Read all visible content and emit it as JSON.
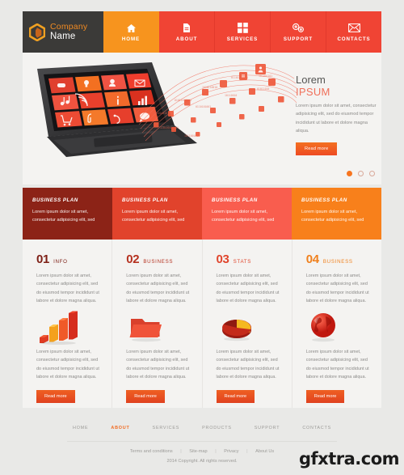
{
  "brand": {
    "logo_icon": "hexagon-ring-icon",
    "name_line1": "Company",
    "name_line2": "Name",
    "accent_orange": "#f7941e",
    "accent_red": "#f04434"
  },
  "nav": {
    "items": [
      {
        "label": "HOME",
        "icon": "home-icon",
        "active": true
      },
      {
        "label": "ABOUT",
        "icon": "document-icon",
        "active": false
      },
      {
        "label": "SERVICES",
        "icon": "grid-icon",
        "active": false
      },
      {
        "label": "SUPPORT",
        "icon": "gears-icon",
        "active": false
      },
      {
        "label": "CONTACTS",
        "icon": "envelope-icon",
        "active": false
      }
    ]
  },
  "hero": {
    "image_alt": "laptop-with-app-tiles",
    "title_line1": "Lorem",
    "title_line2": "IPSUM",
    "paragraph": "Lorem ipsum dolor sit amet, consectetur adipisicing elit, sed do eiusmod tempor incididunt ut labore et dolore magna aliqua.",
    "button_label": "Read more",
    "slider_dots": 3,
    "slider_active_index": 0
  },
  "plans": [
    {
      "title": "BUSINESS PLAN",
      "text": "Lorem ipsum dolor sit amet, consectetur adipisicing elit, sed",
      "color": "#8c2317"
    },
    {
      "title": "BUSINESS PLAN",
      "text": "Lorem ipsum dolor sit amet, consectetur adipisicing elit, sed",
      "color": "#e1432c"
    },
    {
      "title": "BUSINESS PLAN",
      "text": "Lorem ipsum dolor sit amet, consectetur adipisicing elit, sed",
      "color": "#f95d4e"
    },
    {
      "title": "BUSINESS PLAN",
      "text": "Lorem ipsum dolor sit amet, consectetur adipisicing elit, sed",
      "color": "#f8801b"
    }
  ],
  "columns": [
    {
      "number": "01",
      "word": "INFO",
      "color": "#7e2016",
      "art": "bar-chart-3d-icon",
      "text_top": "Lorem ipsum dolor sit amet, consectetur adipisicing elit, sed do eiusmod tempor incididunt ut labore et dolore magna aliqua.",
      "text_bottom": "Lorem ipsum dolor sit amet, consectetur adipisicing elit, sed do eiusmod tempor incididunt ut labore et dolore magna aliqua.",
      "button_label": "Read more"
    },
    {
      "number": "02",
      "word": "BUSINESS",
      "color": "#b5311f",
      "art": "folder-icon",
      "text_top": "Lorem ipsum dolor sit amet, consectetur adipisicing elit, sed do eiusmod tempor incididunt ut labore et dolore magna aliqua.",
      "text_bottom": "Lorem ipsum dolor sit amet, consectetur adipisicing elit, sed do eiusmod tempor incididunt ut labore et dolore magna aliqua.",
      "button_label": "Read more"
    },
    {
      "number": "03",
      "word": "STATS",
      "color": "#e0452c",
      "art": "pie-chart-icon",
      "text_top": "Lorem ipsum dolor sit amet, consectetur adipisicing elit, sed do eiusmod tempor incididunt ut labore et dolore magna aliqua.",
      "text_bottom": "Lorem ipsum dolor sit amet, consectetur adipisicing elit, sed do eiusmod tempor incididunt ut labore et dolore magna aliqua.",
      "button_label": "Read more"
    },
    {
      "number": "04",
      "word": "BUSINESS",
      "color": "#f0801d",
      "art": "globe-icon",
      "text_top": "Lorem ipsum dolor sit amet, consectetur adipisicing elit, sed do eiusmod tempor incididunt ut labore et dolore magna aliqua.",
      "text_bottom": "Lorem ipsum dolor sit amet, consectetur adipisicing elit, sed do eiusmod tempor incididunt ut labore et dolore magna aliqua.",
      "button_label": "Read more"
    }
  ],
  "footer": {
    "nav": [
      {
        "label": "HOME",
        "active": false
      },
      {
        "label": "ABOUT",
        "active": true
      },
      {
        "label": "SERVICES",
        "active": false
      },
      {
        "label": "PRODUCTS",
        "active": false
      },
      {
        "label": "SUPPORT",
        "active": false
      },
      {
        "label": "CONTACTS",
        "active": false
      }
    ],
    "links": [
      "Terms and conditions",
      "Site-map",
      "Privacy",
      "About Us"
    ],
    "divider": "|",
    "copyright": "2014 Copyright. All rights reserved."
  },
  "watermark": {
    "text": "gfxtra.com"
  }
}
